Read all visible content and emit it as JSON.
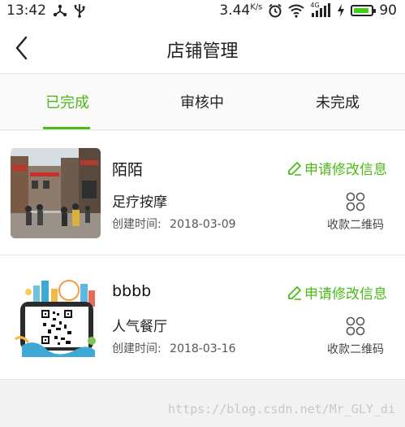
{
  "status_bar": {
    "time": "13:42",
    "network_speed": "3.44",
    "network_unit": "K/s",
    "signal_type": "4G",
    "battery_level": "90",
    "battery_fraction": 0.9,
    "icons": [
      "share-icon",
      "usb-icon",
      "alarm-icon",
      "wifi-icon",
      "cellular-signal-icon",
      "charging-icon",
      "battery-icon"
    ]
  },
  "header": {
    "title": "店铺管理",
    "back_icon": "chevron-left-icon"
  },
  "tabs": [
    {
      "label": "已完成",
      "active": true
    },
    {
      "label": "审核中",
      "active": false
    },
    {
      "label": "未完成",
      "active": false
    }
  ],
  "shops": [
    {
      "name": "陌陌",
      "category": "足疗按摩",
      "created_label": "创建时间:",
      "created_date": "2018-03-09",
      "edit_label": "申请修改信息",
      "qr_label": "收款二维码"
    },
    {
      "name": "bbbb",
      "category": "人气餐厅",
      "created_label": "创建时间:",
      "created_date": "2018-03-16",
      "edit_label": "申请修改信息",
      "qr_label": "收款二维码"
    }
  ],
  "watermark": "https://blog.csdn.net/Mr_GLY_di",
  "colors": {
    "accent": "#4cbb17",
    "background": "#f2f2f2",
    "card": "#ffffff"
  }
}
